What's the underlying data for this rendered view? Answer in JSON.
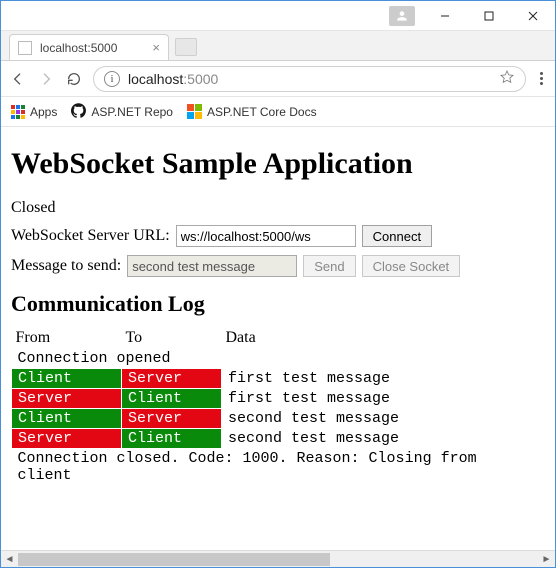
{
  "window": {
    "tab_title": "localhost:5000",
    "url_host": "localhost",
    "url_path": ":5000"
  },
  "bookmarks": {
    "apps_label": "Apps",
    "items": [
      {
        "label": "ASP.NET Repo"
      },
      {
        "label": "ASP.NET Core Docs"
      }
    ]
  },
  "page": {
    "heading": "WebSocket Sample Application",
    "state_label": "Closed",
    "url_label": "WebSocket Server URL:",
    "url_value": "ws://localhost:5000/ws",
    "connect_label": "Connect",
    "msg_label": "Message to send:",
    "msg_value": "second test message",
    "send_label": "Send",
    "close_label": "Close Socket",
    "log_heading": "Communication Log",
    "log_headers": {
      "from": "From",
      "to": "To",
      "data": "Data"
    },
    "log_open": "Connection opened",
    "log_rows": [
      {
        "from": "Client",
        "from_cls": "client",
        "to": "Server",
        "to_cls": "server",
        "data": "first test message"
      },
      {
        "from": "Server",
        "from_cls": "server",
        "to": "Client",
        "to_cls": "client",
        "data": "first test message"
      },
      {
        "from": "Client",
        "from_cls": "client",
        "to": "Server",
        "to_cls": "server",
        "data": "second test message"
      },
      {
        "from": "Server",
        "from_cls": "server",
        "to": "Client",
        "to_cls": "client",
        "data": "second test message"
      }
    ],
    "log_closed": "Connection closed. Code: 1000. Reason: Closing from client"
  }
}
